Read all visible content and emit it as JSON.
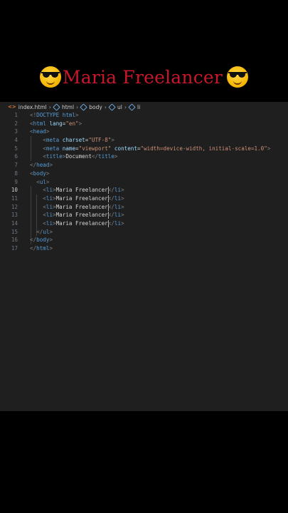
{
  "title": {
    "text": "Maria Freelancer",
    "left_emoji": "smiling-face-with-sunglasses-emoji",
    "right_emoji": "smiling-face-with-sunglasses-emoji",
    "color": "#c8172b"
  },
  "breadcrumb": {
    "items": [
      "index.html",
      "html",
      "body",
      "ul",
      "li"
    ]
  },
  "editor": {
    "active_line": 10,
    "line_numbers": [
      "1",
      "2",
      "3",
      "4",
      "5",
      "6",
      "7",
      "8",
      "9",
      "10",
      "11",
      "12",
      "13",
      "14",
      "15",
      "16",
      "17"
    ],
    "lines": [
      "<!DOCTYPE html>",
      "<html lang=\"en\">",
      "<head>",
      "    <meta charset=\"UTF-8\">",
      "    <meta name=\"viewport\" content=\"width=device-width, initial-scale=1.0\">",
      "    <title>Document</title>",
      "</head>",
      "<body>",
      "  <ul>",
      "    <li>Maria Freelancer</li>",
      "    <li>Maria Freelancer</li>",
      "    <li>Maria Freelancer</li>",
      "    <li>Maria Freelancer</li>",
      "    <li>Maria Freelancer</li>",
      "  </ul>",
      "</body>",
      "</html>"
    ],
    "syntax_colors": {
      "tag": "#569cd6",
      "attribute": "#9cdcfe",
      "string": "#ce9178",
      "text": "#d4d4d4",
      "punctuation": "#808080"
    }
  }
}
